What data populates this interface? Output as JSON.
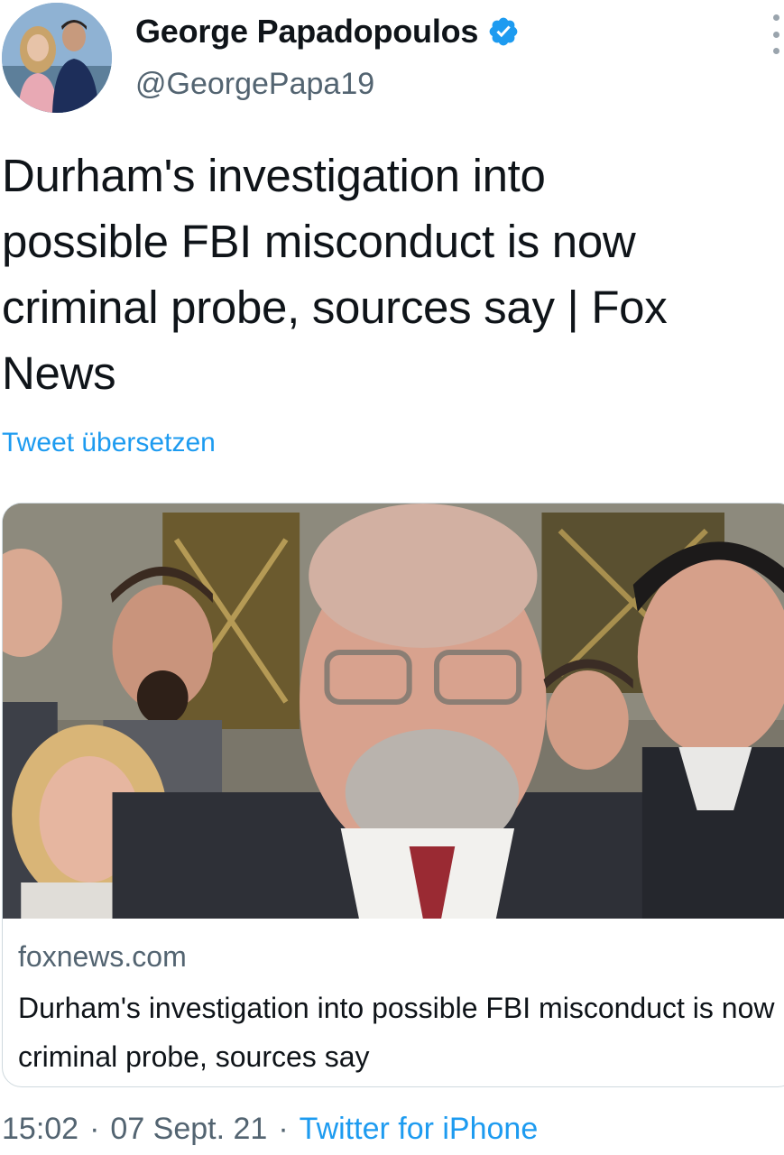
{
  "author": {
    "display_name": "George Papadopoulos",
    "handle": "@GeorgePapa19",
    "verified": true,
    "avatar_icon": "profile-photo"
  },
  "menu_icon": "more-options-vertical-icon",
  "tweet": {
    "text": "Durham's investigation into\npossible FBI misconduct is now\ncriminal probe, sources say | Fox\nNews",
    "translate_label": "Tweet übersetzen"
  },
  "card": {
    "image_icon": "news-photo",
    "domain": "foxnews.com",
    "title": "Durham's investigation into possible FBI misconduct is now criminal probe, sources say"
  },
  "footer": {
    "time": "15:02",
    "date": "07 Sept. 21",
    "separator": "·",
    "source": "Twitter for iPhone"
  },
  "colors": {
    "link": "#1d9bf0",
    "secondary_text": "#536471",
    "verified_badge": "#1d9bf0"
  }
}
